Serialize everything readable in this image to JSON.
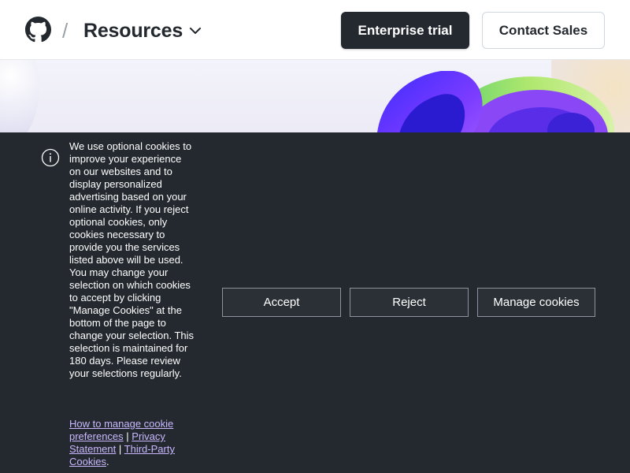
{
  "header": {
    "logo_icon": "github-mark-icon",
    "separator": "/",
    "section_title": "Resources",
    "dropdown_icon": "chevron-down-icon",
    "enterprise_trial_label": "Enterprise trial",
    "contact_sales_label": "Contact Sales"
  },
  "cookie_banner": {
    "icon": "info-icon",
    "message": "We use optional cookies to improve your experience on our websites and to display personalized advertising based on your online activity. If you reject optional cookies, only cookies necessary to provide you the services listed above will be used. You may change your selection on which cookies to accept by clicking \"Manage Cookies\" at the bottom of the page to change your selection. This selection is maintained for 180 days. Please review your selections regularly.",
    "links": {
      "manage_preferences": "How to manage cookie preferences",
      "separator": "|",
      "privacy_statement": "Privacy Statement",
      "third_party": "Third-Party Cookies",
      "end": "."
    },
    "accept_label": "Accept",
    "reject_label": "Reject",
    "manage_label": "Manage cookies"
  },
  "colors": {
    "header_bg": "#ffffff",
    "primary_button": "#24292f",
    "banner_bg": "#24292f",
    "link_color": "#c9b8ff"
  }
}
